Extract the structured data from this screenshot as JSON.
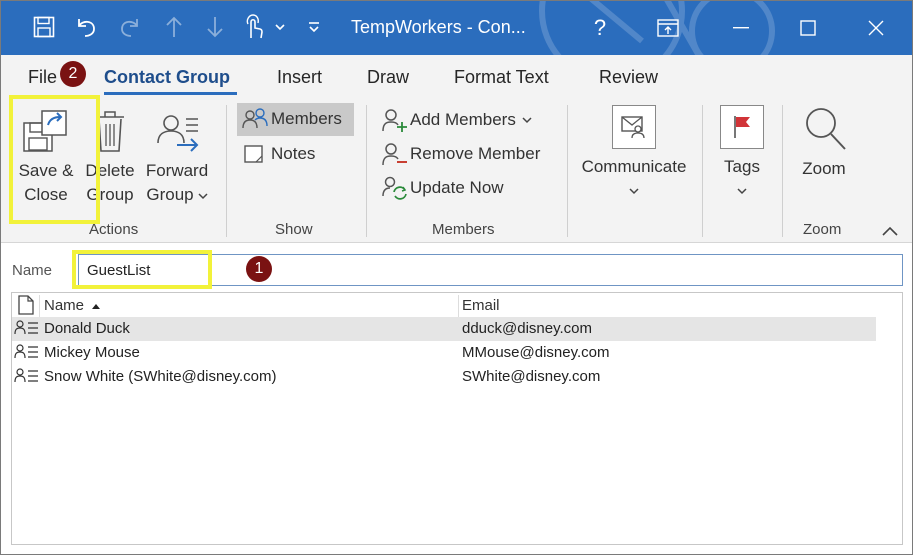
{
  "titlebar": {
    "title": "TempWorkers  -  Con...",
    "help": "?",
    "colors": {
      "bar": "#2b6dbd"
    }
  },
  "tabs": [
    {
      "label": "File"
    },
    {
      "label": "Contact Group"
    },
    {
      "label": "Insert"
    },
    {
      "label": "Draw"
    },
    {
      "label": "Format Text"
    },
    {
      "label": "Review"
    }
  ],
  "ribbon": {
    "actions": {
      "save_close": "Save &\nClose",
      "delete_group": "Delete\nGroup",
      "forward_group": "Forward\nGroup",
      "label": "Actions"
    },
    "show": {
      "members": "Members",
      "notes": "Notes",
      "label": "Show"
    },
    "members": {
      "add_members": "Add Members",
      "remove_member": "Remove Member",
      "update_now": "Update Now",
      "label": "Members"
    },
    "communicate": "Communicate",
    "tags": "Tags",
    "zoom": {
      "button": "Zoom",
      "label": "Zoom"
    }
  },
  "badges": {
    "one": "1",
    "two": "2"
  },
  "form": {
    "name_label": "Name",
    "name_value": "GuestList"
  },
  "list": {
    "columns": {
      "name": "Name",
      "email": "Email"
    },
    "rows": [
      {
        "name": "Donald Duck",
        "email": "dduck@disney.com",
        "selected": true
      },
      {
        "name": "Mickey Mouse",
        "email": "MMouse@disney.com",
        "selected": false
      },
      {
        "name": "Snow White (SWhite@disney.com)",
        "email": "SWhite@disney.com",
        "selected": false
      }
    ]
  },
  "icons": [
    "save-icon",
    "undo-icon",
    "redo-icon",
    "up-arrow-icon",
    "down-arrow-icon",
    "touch-mode-icon",
    "customize-icon",
    "restore-ribbon-icon",
    "minimize-icon",
    "maximize-icon",
    "close-icon",
    "save-close-icon",
    "delete-icon",
    "forward-group-icon",
    "members-icon",
    "notes-icon",
    "add-member-icon",
    "remove-member-icon",
    "update-now-icon",
    "communicate-icon",
    "tags-flag-icon",
    "zoom-icon",
    "collapse-ribbon-icon",
    "document-icon",
    "contact-icon"
  ]
}
